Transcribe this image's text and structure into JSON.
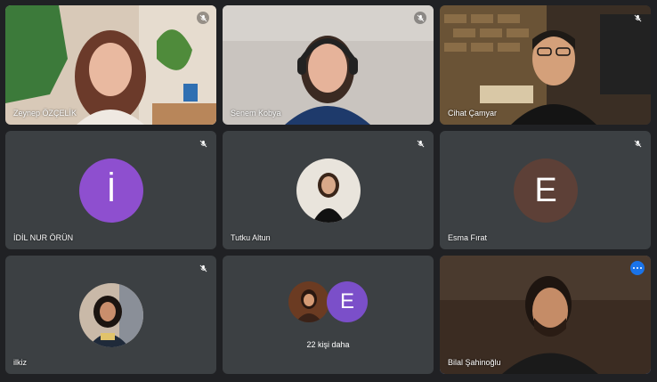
{
  "participants": [
    {
      "name": "Zeynep ÖZÇELİK",
      "muted": true,
      "kind": "video"
    },
    {
      "name": "Senem Kobya",
      "muted": true,
      "kind": "video"
    },
    {
      "name": "Cihat Çamyar",
      "muted": true,
      "kind": "video"
    },
    {
      "name": "İDİL NUR ÖRÜN",
      "muted": true,
      "kind": "letter",
      "letter": "İ",
      "color": "#8e4fcf"
    },
    {
      "name": "Tutku Altun",
      "muted": true,
      "kind": "photo"
    },
    {
      "name": "Esma Fırat",
      "muted": true,
      "kind": "letter",
      "letter": "E",
      "color": "#5d4037"
    },
    {
      "name": "ilkiz",
      "muted": true,
      "kind": "photo"
    },
    {
      "more_label": "22 kişi daha",
      "stack_letter": "E",
      "stack_color": "#7b4fc9"
    },
    {
      "name": "Bilal Şahinoğlu",
      "muted": false,
      "kind": "video",
      "active": true
    }
  ],
  "colors": {
    "background": "#202124",
    "tile": "#3c4043",
    "active_border": "#4a8af4",
    "more_button": "#1a73e8"
  },
  "icons": [
    "mic-off-icon",
    "more-options-icon"
  ]
}
